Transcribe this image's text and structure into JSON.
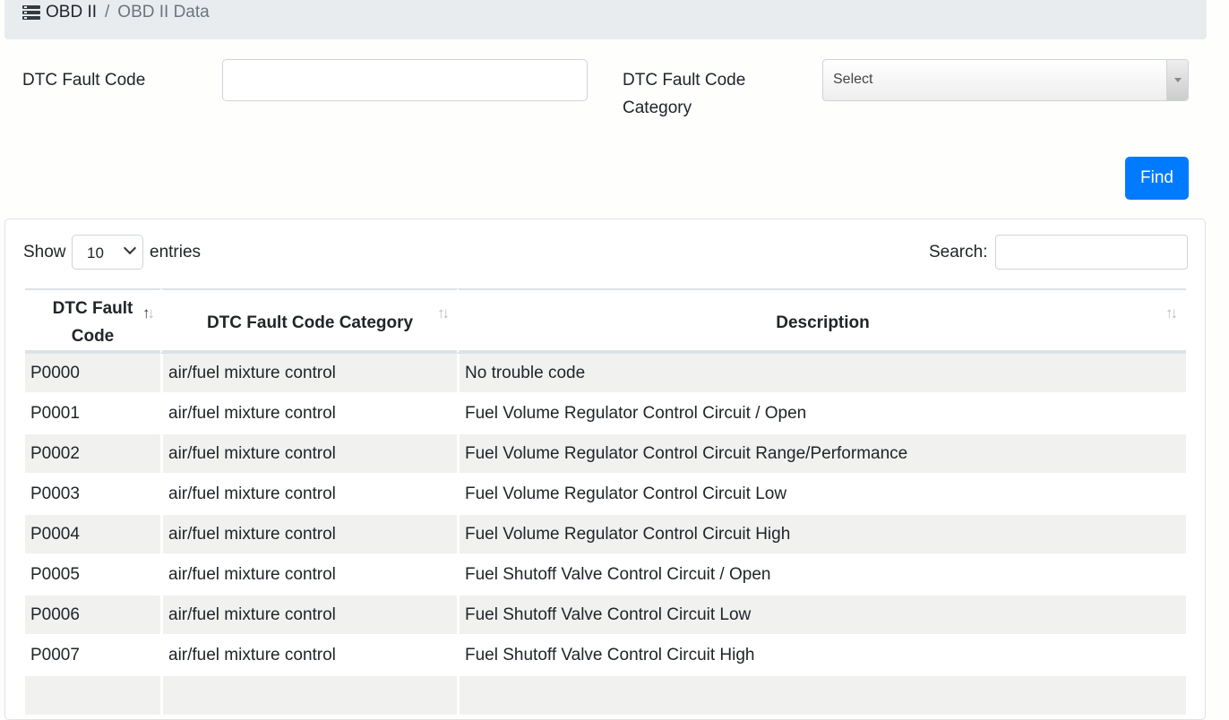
{
  "breadcrumb": {
    "icon": "server-icon",
    "home": "OBD II",
    "separator": "/",
    "current": "OBD II Data"
  },
  "filters": {
    "fault_code_label": "DTC Fault Code",
    "fault_code_value": "",
    "category_label_line1": "DTC Fault Code",
    "category_label_line2": "Category",
    "category_selected": "Select",
    "find_label": "Find"
  },
  "table_controls": {
    "show_label": "Show",
    "entries_value": "10",
    "entries_label": "entries",
    "search_label": "Search:",
    "search_value": ""
  },
  "table": {
    "headers": [
      {
        "line1": "DTC Fault",
        "line2": "Code",
        "sort": "asc"
      },
      {
        "line1": "DTC Fault Code Category",
        "sort": "none"
      },
      {
        "line1": "Description",
        "sort": "none"
      }
    ],
    "rows": [
      {
        "code": "P0000",
        "category": "air/fuel mixture control",
        "description": "No trouble code"
      },
      {
        "code": "P0001",
        "category": "air/fuel mixture control",
        "description": "Fuel Volume Regulator Control Circuit / Open"
      },
      {
        "code": "P0002",
        "category": "air/fuel mixture control",
        "description": "Fuel Volume Regulator Control Circuit Range/Performance"
      },
      {
        "code": "P0003",
        "category": "air/fuel mixture control",
        "description": "Fuel Volume Regulator Control Circuit Low"
      },
      {
        "code": "P0004",
        "category": "air/fuel mixture control",
        "description": "Fuel Volume Regulator Control Circuit High"
      },
      {
        "code": "P0005",
        "category": "air/fuel mixture control",
        "description": "Fuel Shutoff Valve Control Circuit / Open"
      },
      {
        "code": "P0006",
        "category": "air/fuel mixture control",
        "description": "Fuel Shutoff Valve Control Circuit Low"
      },
      {
        "code": "P0007",
        "category": "air/fuel mixture control",
        "description": "Fuel Shutoff Valve Control Circuit High"
      },
      {
        "code": "",
        "category": "",
        "description": ""
      }
    ]
  },
  "colors": {
    "accent": "#007bff",
    "breadcrumb_bg": "#e9ecef",
    "stripe": "#f1f1f0"
  }
}
